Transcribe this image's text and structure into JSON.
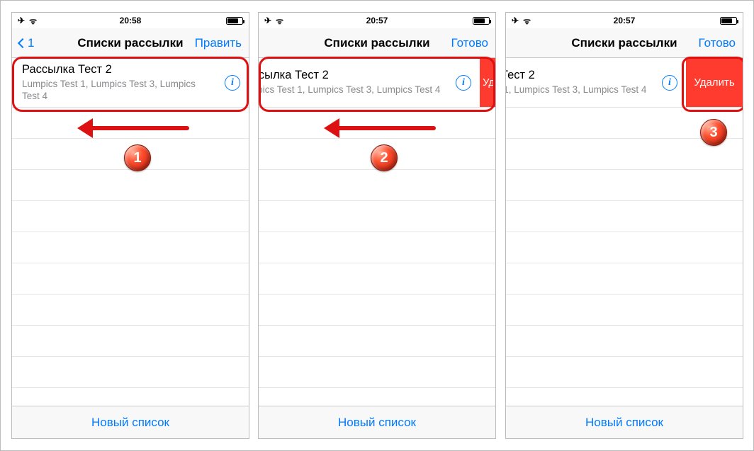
{
  "statusbar": {
    "airplane_glyph": "✈",
    "wifi_glyph": "ᯤ"
  },
  "nav": {
    "title": "Списки рассылки",
    "back_count": "1"
  },
  "list_item": {
    "title": "Рассылка Тест 2",
    "subtitle": "Lumpics Test 1, Lumpics Test 3, Lumpics Test 4",
    "info_glyph": "i"
  },
  "delete": {
    "full": "Удалить",
    "partial": "Уд"
  },
  "footer": {
    "new_list": "Новый список"
  },
  "panes": [
    {
      "time": "20:58",
      "action": "Править",
      "step": "1",
      "show_back": true,
      "swipe": "none",
      "highlight": "cell"
    },
    {
      "time": "20:57",
      "action": "Готово",
      "step": "2",
      "show_back": false,
      "swipe": "partial",
      "highlight": "cell"
    },
    {
      "time": "20:57",
      "action": "Готово",
      "step": "3",
      "show_back": false,
      "swipe": "full",
      "highlight": "delete"
    }
  ]
}
